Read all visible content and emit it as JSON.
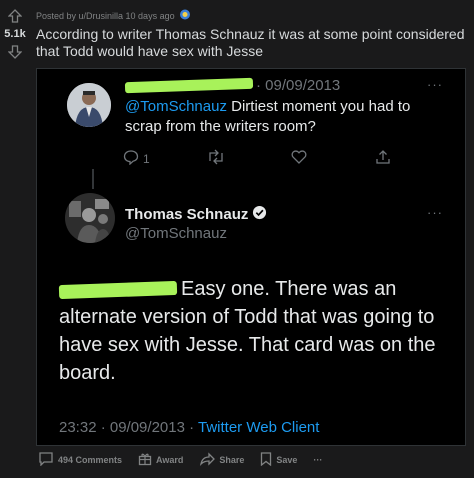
{
  "vote": {
    "score": "5.1k"
  },
  "meta": {
    "posted_by": "Posted by u/Drusinilla 10 days ago"
  },
  "post": {
    "title": "According to writer Thomas Schnauz it was at some point considered that Todd would have sex with Jesse"
  },
  "tweet1": {
    "date": "· 09/09/2013",
    "mention": "@TomSchnauz",
    "text": " Dirtiest moment you had to scrap from the writers room?",
    "reply_count": "1"
  },
  "tweet2": {
    "name": "Thomas Schnauz",
    "handle": "@TomSchnauz",
    "text": "Easy one.  There was an alternate version of Todd that was going to have sex with Jesse.  That card was on the board.",
    "time": "23:32 · 09/09/2013 · ",
    "client": "Twitter Web Client"
  },
  "actions": {
    "comments": "494 Comments",
    "award": "Award",
    "share": "Share",
    "save": "Save",
    "more": "···"
  },
  "colors": {
    "background": "#1a1a1b",
    "tweet_bg": "#000000",
    "link": "#1d9bf0",
    "redaction": "#a8f25a"
  }
}
